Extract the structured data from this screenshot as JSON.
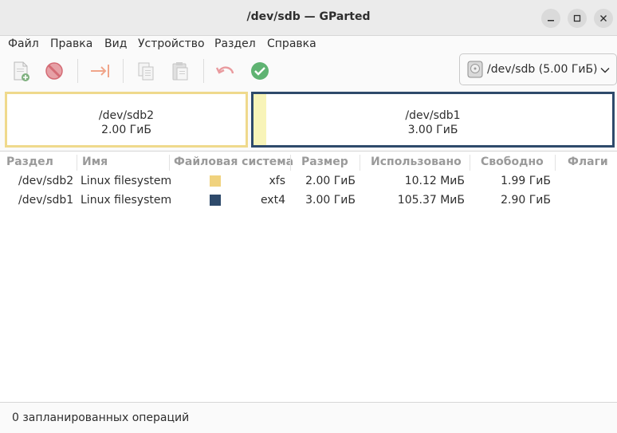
{
  "window": {
    "title": "/dev/sdb — GParted"
  },
  "menubar": {
    "items": [
      "Файл",
      "Правка",
      "Вид",
      "Устройство",
      "Раздел",
      "Справка"
    ]
  },
  "toolbar": {
    "icons": [
      "new-partition-icon",
      "delete-partition-icon",
      "resize-move-icon",
      "copy-icon",
      "paste-icon",
      "undo-icon",
      "apply-icon"
    ]
  },
  "device": {
    "label": "/dev/sdb (5.00 ГиБ)"
  },
  "graph": {
    "partitions": [
      {
        "name": "/dev/sdb2",
        "size": "2.00 ГиБ",
        "color": "#e8d27f"
      },
      {
        "name": "/dev/sdb1",
        "size": "3.00 ГиБ",
        "color": "#2e4a6b"
      }
    ]
  },
  "table": {
    "headers": [
      "Раздел",
      "Имя",
      "Файловая система",
      "Размер",
      "Использовано",
      "Свободно",
      "Флаги"
    ],
    "rows": [
      {
        "partition": "/dev/sdb2",
        "name": "Linux filesystem",
        "fs_color": "#f0d27e",
        "fs": "xfs",
        "size": "2.00 ГиБ",
        "used": "10.12 МиБ",
        "free": "1.99 ГиБ",
        "flags": ""
      },
      {
        "partition": "/dev/sdb1",
        "name": "Linux filesystem",
        "fs_color": "#2e4a6b",
        "fs": "ext4",
        "size": "3.00 ГиБ",
        "used": "105.37 МиБ",
        "free": "2.90 ГиБ",
        "flags": ""
      }
    ]
  },
  "status": {
    "text": "0 запланированных операций"
  }
}
